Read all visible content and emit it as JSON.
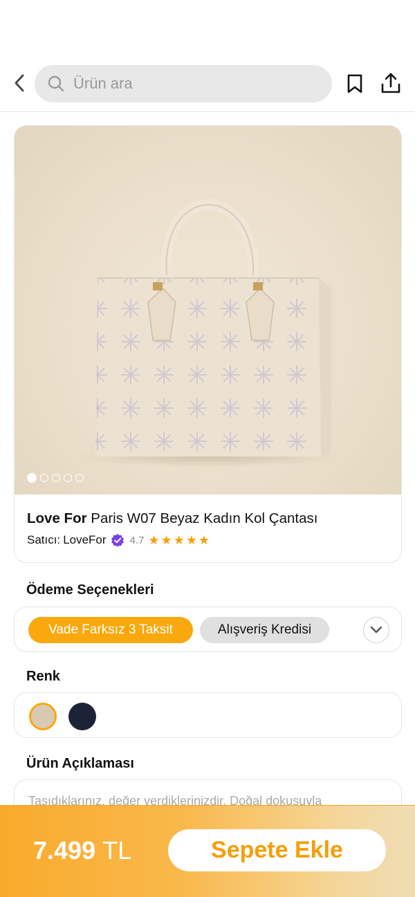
{
  "header": {
    "search_placeholder": "Ürün ara",
    "back_icon": "chevron-left-icon",
    "bookmark_icon": "bookmark-icon",
    "share_icon": "share-icon"
  },
  "product": {
    "brand": "Love For",
    "name": "Paris W07 Beyaz Kadın Kol Çantası",
    "seller_label": "Satıcı:",
    "seller_name": "LoveFor",
    "seller_verified": true,
    "rating": "4.7",
    "stars": [
      "★",
      "★",
      "★",
      "★",
      "★"
    ],
    "image_count": 5,
    "image_active_index": 0
  },
  "payment": {
    "title": "Ödeme Seçenekleri",
    "options": [
      "Vade Farksız 3 Taksit",
      "Alışveriş Kredisi"
    ],
    "selected": "Vade Farksız 3 Taksit"
  },
  "color": {
    "title": "Renk",
    "swatches": [
      {
        "name": "beige",
        "hex": "#d9c9b3",
        "selected": true
      },
      {
        "name": "navy",
        "hex": "#1d2337",
        "selected": false
      }
    ]
  },
  "description": {
    "title": "Ürün Açıklaması",
    "text": "Taşıdıklarınız, değer verdiklerinizdir. Doğal dokusuyla"
  },
  "cart": {
    "price": "7.499",
    "currency": "TL",
    "button_label": "Sepete Ekle"
  },
  "colors": {
    "accent": "#f9a80d",
    "verified": "#7b3fe4",
    "star": "#f5a00b"
  }
}
